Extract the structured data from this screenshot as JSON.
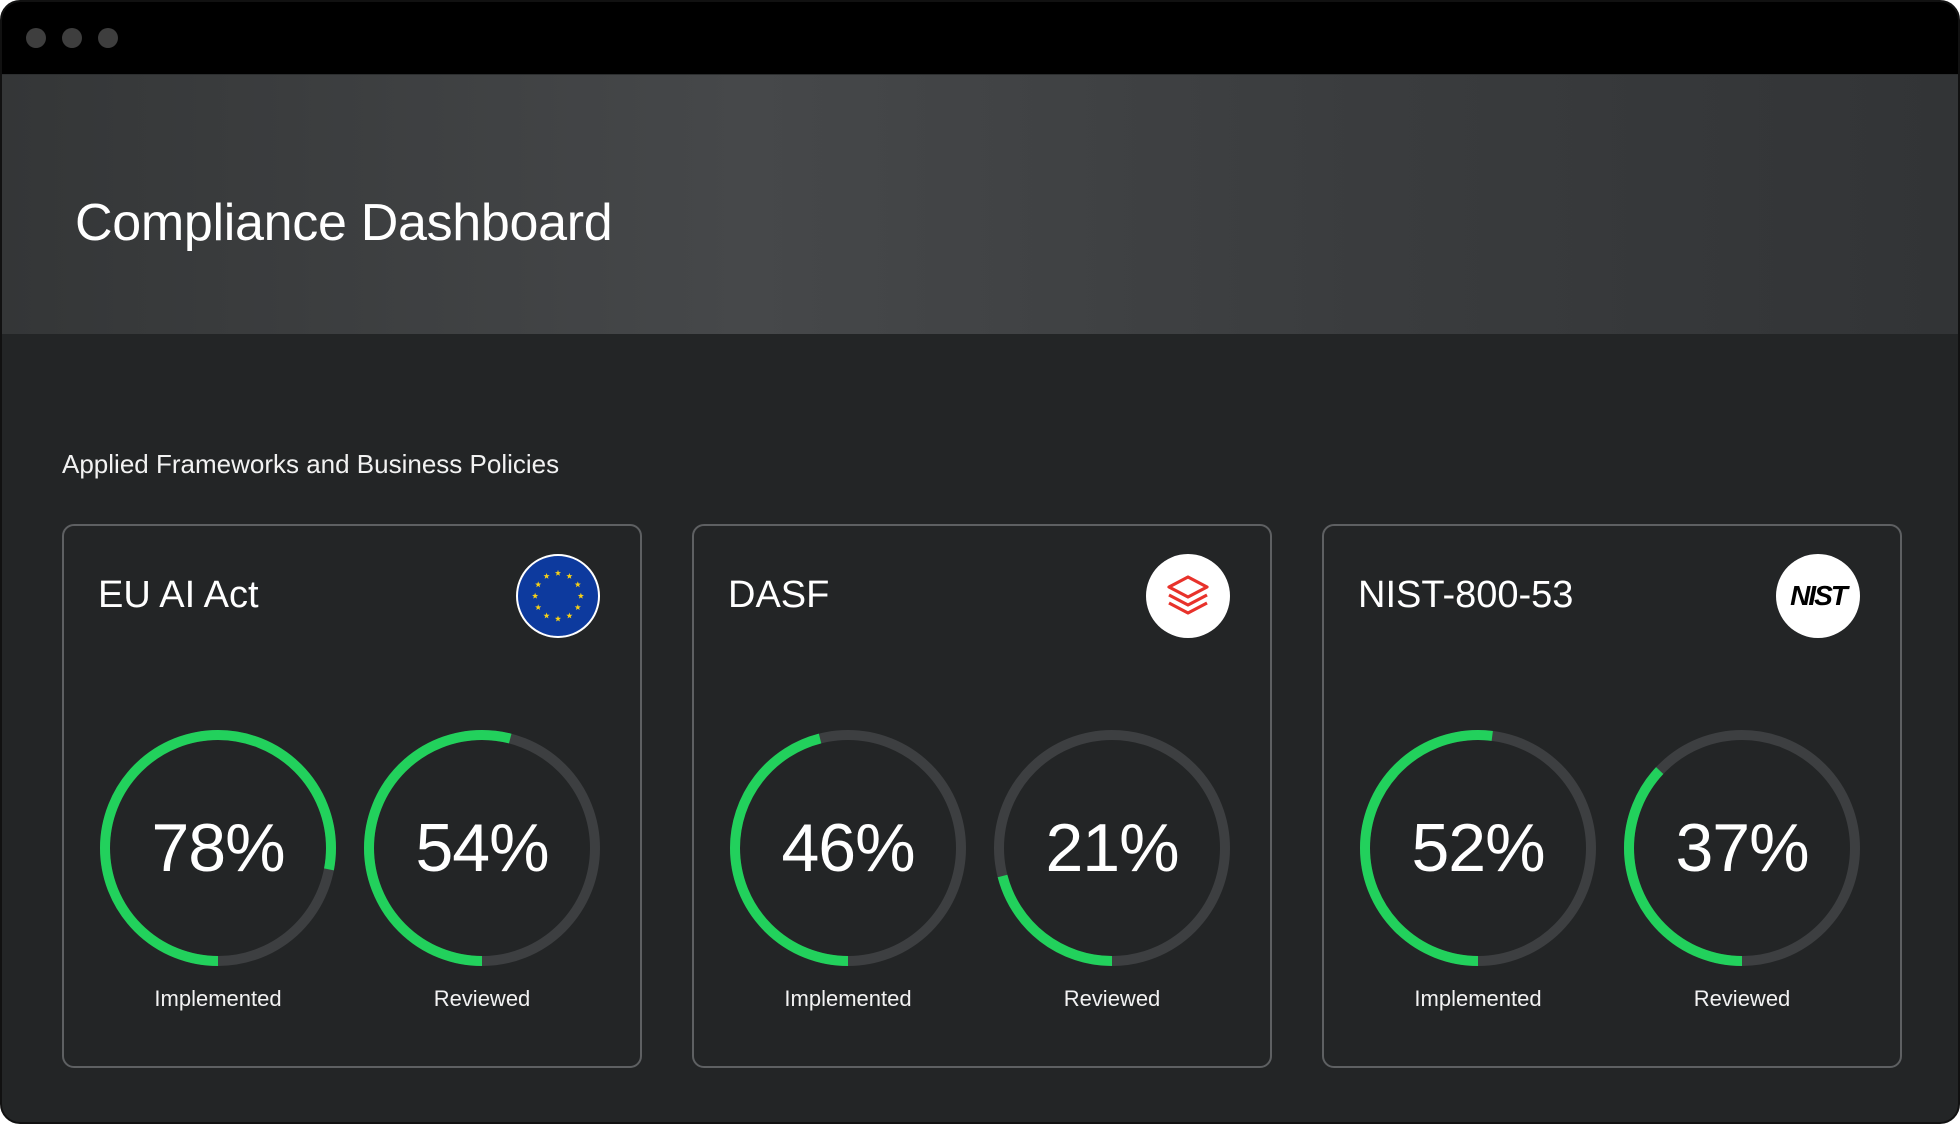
{
  "header": {
    "title": "Compliance Dashboard"
  },
  "section": {
    "title": "Applied Frameworks and Business Policies"
  },
  "colors": {
    "accent": "#22d15c",
    "track": "#3d3f41"
  },
  "frameworks": [
    {
      "name": "EU AI Act",
      "logo_icon": "eu-flag-icon",
      "implemented": {
        "label": "Implemented",
        "value": "78%",
        "fraction": 0.78
      },
      "reviewed": {
        "label": "Reviewed",
        "value": "54%",
        "fraction": 0.54
      }
    },
    {
      "name": "DASF",
      "logo_icon": "databricks-icon",
      "implemented": {
        "label": "Implemented",
        "value": "46%",
        "fraction": 0.46
      },
      "reviewed": {
        "label": "Reviewed",
        "value": "21%",
        "fraction": 0.21
      }
    },
    {
      "name": "NIST-800-53",
      "logo_icon": "nist-logo-icon",
      "logo_text": "NIST",
      "implemented": {
        "label": "Implemented",
        "value": "52%",
        "fraction": 0.52
      },
      "reviewed": {
        "label": "Reviewed",
        "value": "37%",
        "fraction": 0.37
      }
    }
  ]
}
